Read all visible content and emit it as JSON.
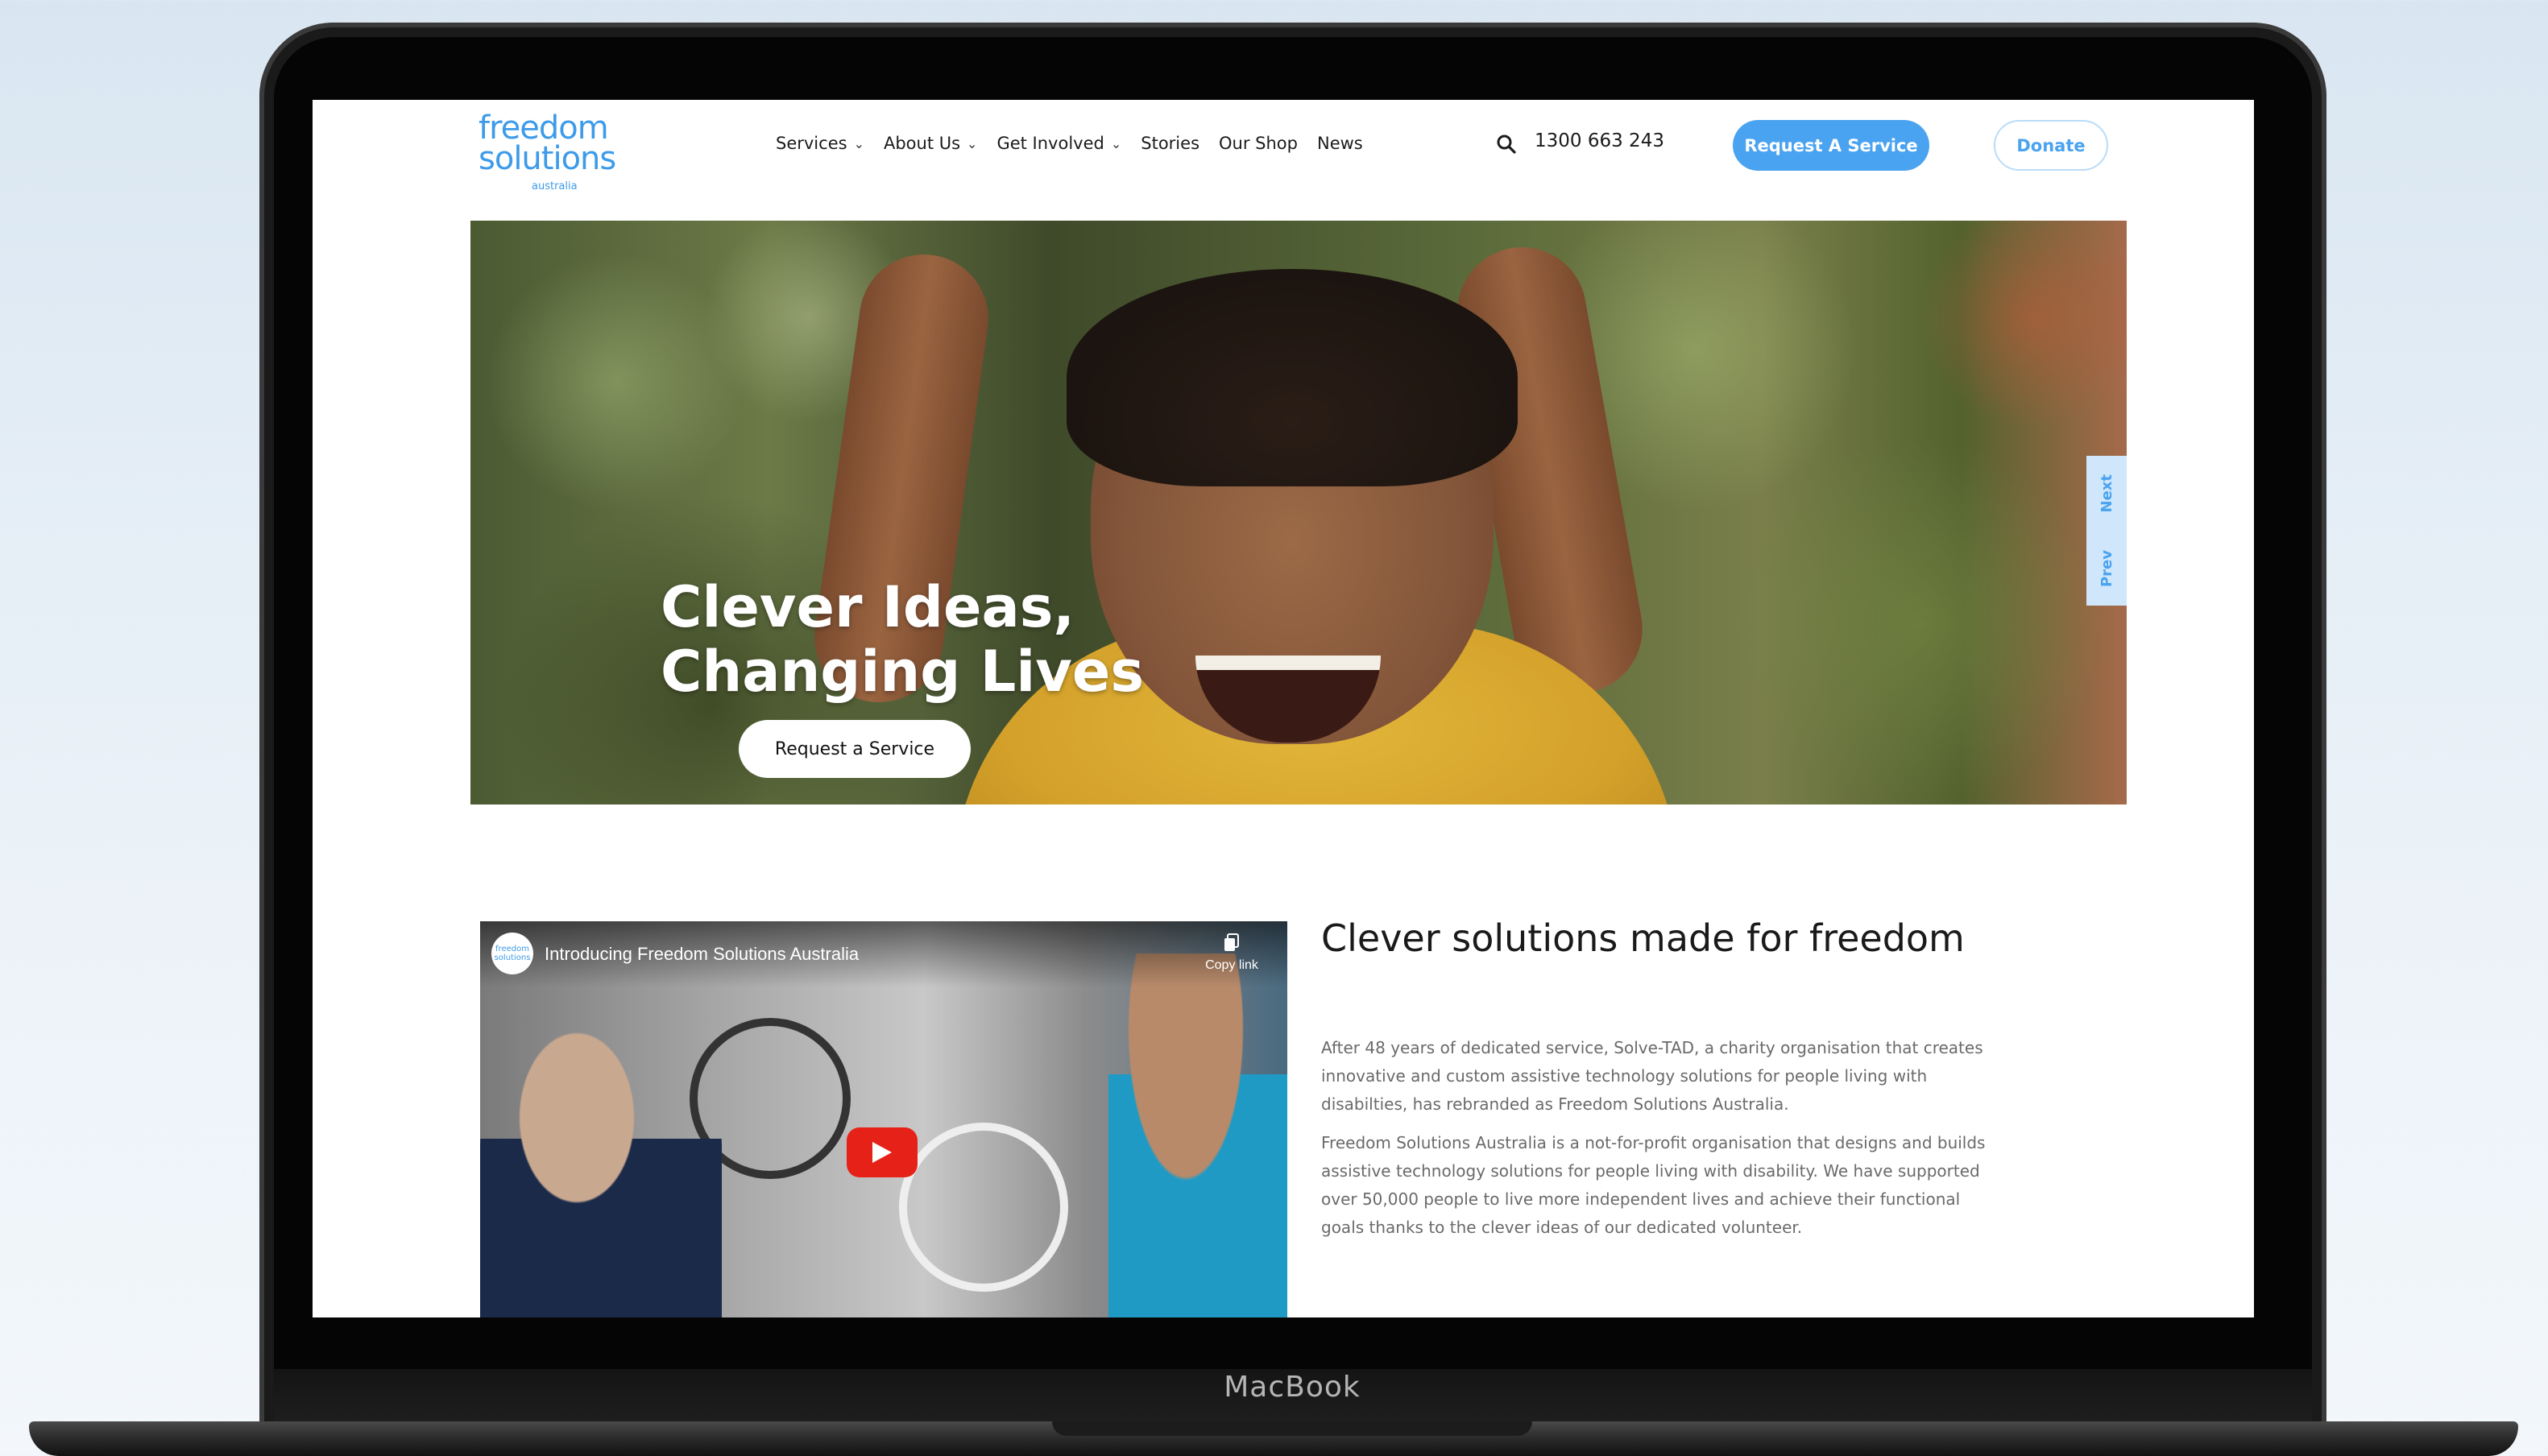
{
  "device": {
    "label": "MacBook"
  },
  "header": {
    "logo": {
      "line1": "freedom",
      "line2": "solutions",
      "sub": "australia"
    },
    "nav": [
      {
        "label": "Services",
        "has_dropdown": true
      },
      {
        "label": "About Us",
        "has_dropdown": true
      },
      {
        "label": "Get Involved",
        "has_dropdown": true
      },
      {
        "label": "Stories",
        "has_dropdown": false
      },
      {
        "label": "Our Shop",
        "has_dropdown": false
      },
      {
        "label": "News",
        "has_dropdown": false
      }
    ],
    "phone": "1300 663 243",
    "request_button": "Request A Service",
    "donate_button": "Donate"
  },
  "hero": {
    "title": "Clever Ideas, Changing Lives",
    "button": "Request a Service",
    "slider": {
      "next": "Next",
      "prev": "Prev"
    }
  },
  "video": {
    "title": "Introducing Freedom Solutions Australia",
    "copy_link": "Copy link",
    "channel_avatar": "freedom solutions"
  },
  "about": {
    "title": "Clever solutions made for freedom",
    "paragraph1": "After 48 years of dedicated service, Solve-TAD, a charity organisation that creates innovative and custom assistive technology solutions for people living with disabilties, has rebranded as Freedom Solutions Australia.",
    "paragraph2": "Freedom Solutions Australia is a not-for-profit organisation that designs and builds assistive technology solutions for people living with disability. We have supported over 50,000 people to live more independent lives and achieve their functional goals thanks to the clever ideas of our dedicated volunteer."
  },
  "colors": {
    "brand_blue": "#4aa3f0",
    "text_dark": "#1a1a1a",
    "text_muted": "#6a6a6a",
    "youtube_red": "#e62117"
  }
}
